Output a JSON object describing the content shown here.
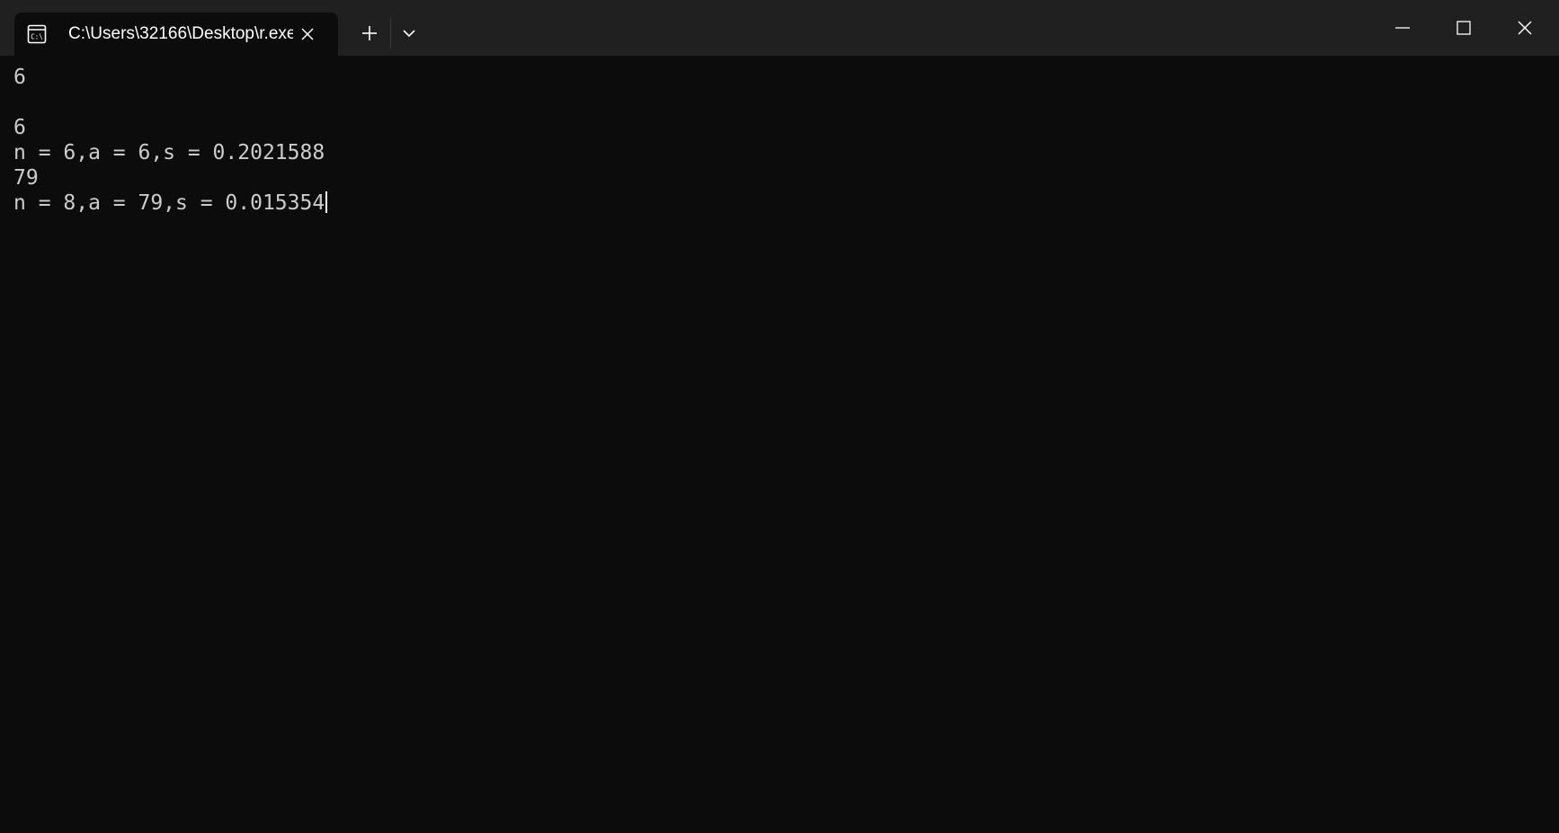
{
  "window": {
    "tab": {
      "title": "C:\\Users\\32166\\Desktop\\r.exe",
      "icon": "terminal-icon"
    },
    "icons": {
      "tab_close": "close-icon",
      "new_tab": "plus-icon",
      "dropdown": "chevron-down-icon",
      "minimize": "minimize-icon",
      "maximize": "maximize-icon",
      "close": "close-icon"
    },
    "colors": {
      "background": "#0c0c0c",
      "titlebar": "#202020",
      "text": "#cccccc"
    }
  },
  "terminal": {
    "lines": [
      "6",
      "",
      "6",
      "n = 6,a = 6,s = 0.2021588",
      "79",
      "n = 8,a = 79,s = 0.015354"
    ]
  }
}
